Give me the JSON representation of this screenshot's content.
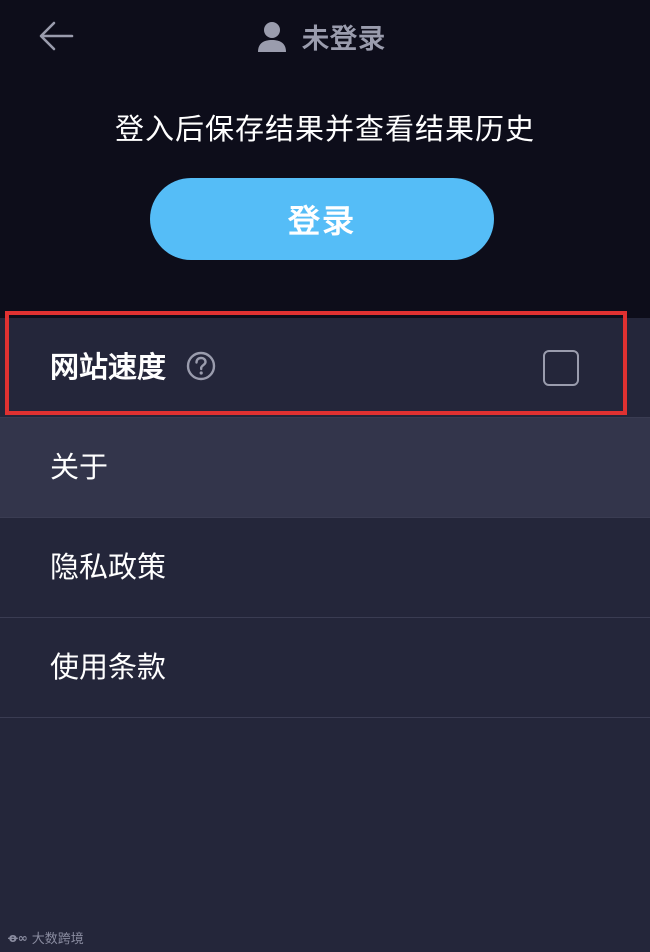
{
  "header": {
    "back_icon": "arrow-left-icon",
    "user_icon": "user-icon",
    "user_label": "未登录"
  },
  "login_section": {
    "prompt": "登入后保存结果并查看结果历史",
    "login_button": "登录"
  },
  "menu": {
    "items": [
      {
        "label": "网站速度",
        "icon": "help-circle-icon",
        "checked": false
      },
      {
        "label": "关于"
      },
      {
        "label": "隐私政策"
      },
      {
        "label": "使用条款"
      }
    ]
  },
  "watermark": {
    "logo": "ꝋ∞",
    "text": "大数跨境"
  },
  "colors": {
    "top_background": "#0d0d1a",
    "menu_background": "#24263a",
    "menu_active": "#33354b",
    "login_button": "#55bdf7",
    "highlight": "#e03131",
    "muted_text": "#9a9cad"
  }
}
